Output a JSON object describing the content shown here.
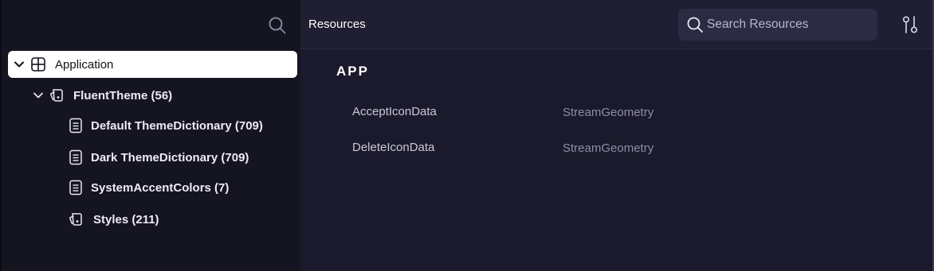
{
  "tree": {
    "root": {
      "label": "Application"
    },
    "theme": {
      "label": "FluentTheme (56)"
    },
    "children": [
      {
        "label": "Default ThemeDictionary (709)"
      },
      {
        "label": "Dark ThemeDictionary (709)"
      },
      {
        "label": "SystemAccentColors (7)"
      },
      {
        "label": "Styles (211)"
      }
    ]
  },
  "header": {
    "title": "Resources",
    "search_placeholder": "Search Resources"
  },
  "section": {
    "title": "APP"
  },
  "resources": [
    {
      "name": "AcceptIconData",
      "type": "StreamGeometry"
    },
    {
      "name": "DeleteIconData",
      "type": "StreamGeometry"
    }
  ]
}
